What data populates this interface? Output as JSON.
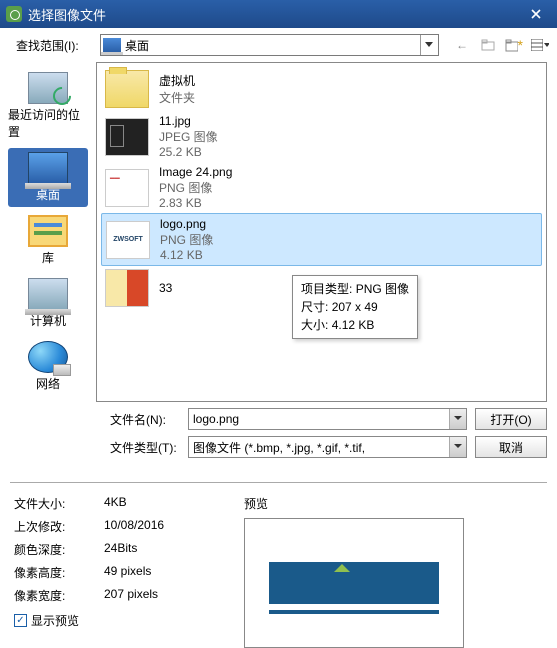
{
  "titlebar": {
    "title": "选择图像文件"
  },
  "top": {
    "scope_label": "查找范围(I):",
    "location": "桌面"
  },
  "places": [
    {
      "key": "recent",
      "label": "最近访问的位置",
      "icon": "ic-recent"
    },
    {
      "key": "desktop",
      "label": "桌面",
      "icon": "ic-desktop",
      "selected": true
    },
    {
      "key": "library",
      "label": "库",
      "icon": "ic-lib"
    },
    {
      "key": "pc",
      "label": "计算机",
      "icon": "ic-pc"
    },
    {
      "key": "network",
      "label": "网络",
      "icon": "ic-net"
    }
  ],
  "files": [
    {
      "name": "虚拟机",
      "type": "文件夹",
      "size": "",
      "thumb": "folder"
    },
    {
      "name": "11.jpg",
      "type": "JPEG 图像",
      "size": "25.2 KB",
      "thumb": "pic-11"
    },
    {
      "name": "Image 24.png",
      "type": "PNG 图像",
      "size": "2.83 KB",
      "thumb": "pic-24"
    },
    {
      "name": "logo.png",
      "type": "PNG 图像",
      "size": "4.12 KB",
      "thumb": "pic-logo",
      "selected": true
    },
    {
      "name": "33",
      "type": "",
      "size": "",
      "thumb": "pic-33"
    }
  ],
  "tooltip": {
    "line1_label": "项目类型:",
    "line1_value": "PNG 图像",
    "line2_label": "尺寸:",
    "line2_value": "207 x 49",
    "line3_label": "大小:",
    "line3_value": "4.12 KB"
  },
  "form": {
    "filename_label": "文件名(N):",
    "filename_value": "logo.png",
    "filetype_label": "文件类型(T):",
    "filetype_value": "图像文件 (*.bmp, *.jpg, *.gif, *.tif,",
    "open_btn": "打开(O)",
    "cancel_btn": "取消"
  },
  "props": {
    "file_size_label": "文件大小:",
    "file_size_value": "4KB",
    "last_mod_label": "上次修改:",
    "last_mod_value": "10/08/2016",
    "color_depth_label": "颜色深度:",
    "color_depth_value": "24Bits",
    "px_height_label": "像素高度:",
    "px_height_value": "49 pixels",
    "px_width_label": "像素宽度:",
    "px_width_value": "207 pixels",
    "show_preview_label": "显示预览"
  },
  "preview": {
    "label": "预览"
  }
}
